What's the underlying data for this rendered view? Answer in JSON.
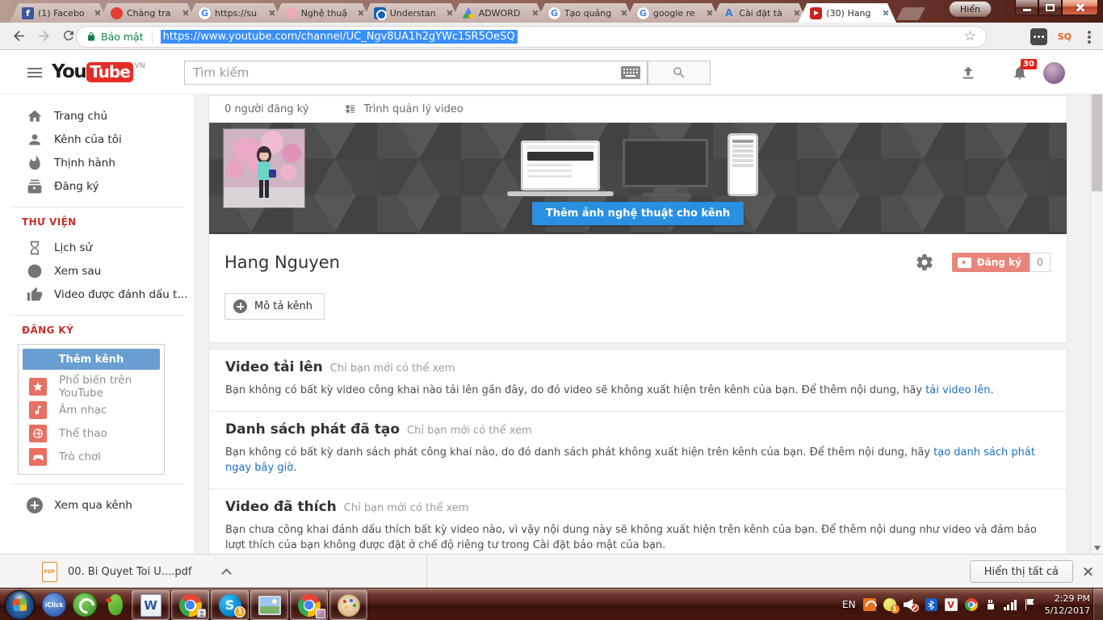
{
  "window": {
    "overlay_button": "Hiển"
  },
  "tabs": [
    {
      "title": "(1) Facebo"
    },
    {
      "title": "Chàng tra"
    },
    {
      "title": "https://su"
    },
    {
      "title": "Nghệ thuậ"
    },
    {
      "title": "Understan"
    },
    {
      "title": "ADWORD"
    },
    {
      "title": "Tạo quảng"
    },
    {
      "title": "google re"
    },
    {
      "title": "Cài đặt tà"
    },
    {
      "title": "(30) Hang"
    }
  ],
  "address_bar": {
    "security_label": "Bảo mật",
    "url": "https://www.youtube.com/channel/UC_Ngv8UA1h2gYWc1SR5OeSQ"
  },
  "icon_text": {
    "facebook": "f",
    "google": "G",
    "adwords_a": "A",
    "sq": "SQ",
    "word": "W",
    "skype": "S",
    "antivirus": "V",
    "pdf": "PDF",
    "iclick": "iClick"
  },
  "yt_header": {
    "logo_you": "You",
    "logo_tube": "Tube",
    "logo_country": "VN",
    "search_placeholder": "Tìm kiếm",
    "notification_count": "30"
  },
  "sidebar": {
    "main_items": [
      {
        "label": "Trang chủ"
      },
      {
        "label": "Kênh của tôi"
      },
      {
        "label": "Thịnh hành"
      },
      {
        "label": "Đăng ký"
      }
    ],
    "library_header": "THƯ VIỆN",
    "library_items": [
      {
        "label": "Lịch sử"
      },
      {
        "label": "Xem sau"
      },
      {
        "label": "Video được đánh dấu t..."
      }
    ],
    "subs_header": "ĐĂNG KÝ",
    "add_channel_button": "Thêm kênh",
    "subscription_items": [
      {
        "label": "Phổ biến trên YouTube"
      },
      {
        "label": "Âm nhạc"
      },
      {
        "label": "Thể thao"
      },
      {
        "label": "Trò chơi"
      }
    ],
    "browse_channels": "Xem qua kênh"
  },
  "channel": {
    "subscriber_count_label": "0 người đăng ký",
    "video_manager_label": "Trình quản lý video",
    "add_art_button": "Thêm ảnh nghệ thuật cho kênh",
    "name": "Hang Nguyen",
    "subscribe_button": "Đăng ký",
    "subscribe_count": "0",
    "description_button": "Mô tả kênh"
  },
  "sections": [
    {
      "title": "Video tải lên",
      "note": "Chỉ bạn mới có thể xem",
      "body": "Bạn không có bất kỳ video công khai nào tải lên gần đây, do đó video sẽ không xuất hiện trên kênh của bạn. Để thêm nội dung, hãy ",
      "link": "tải video lên",
      "suffix": "."
    },
    {
      "title": "Danh sách phát đã tạo",
      "note": "Chỉ bạn mới có thể xem",
      "body": "Bạn không có bất kỳ danh sách phát công khai nào, do đó danh sách phát không xuất hiện trên kênh của bạn. Để thêm nội dung, hãy ",
      "link": "tạo danh sách phát ngay bây giờ",
      "suffix": "."
    },
    {
      "title": "Video đã thích",
      "note": "Chỉ bạn mới có thể xem",
      "body": "Bạn chưa công khai đánh dấu thích bất kỳ video nào, vì vậy nội dung này sẽ không xuất hiện trên kênh của bạn. Để thêm nội dung như video và đảm bảo lượt thích của bạn không được đặt ở chế độ riêng tư trong Cài đặt bảo mật của bạn.",
      "link": "",
      "suffix": ""
    }
  ],
  "download_bar": {
    "filename": "00. Bi Quyet Toi U....pdf",
    "show_all_button": "Hiển thị tất cả"
  },
  "taskbar": {
    "skype_badge": "1",
    "update_badge": "1",
    "tray_lang": "EN",
    "tray_time": "2:29 PM",
    "tray_date": "5/12/2017"
  },
  "colors": {
    "accent_blue": "#2b90e0",
    "subscribe_red": "#e8857b",
    "brand_red": "#cd201f",
    "link_blue": "#1d6fc0",
    "taskbar_maroon": "#53201a"
  }
}
